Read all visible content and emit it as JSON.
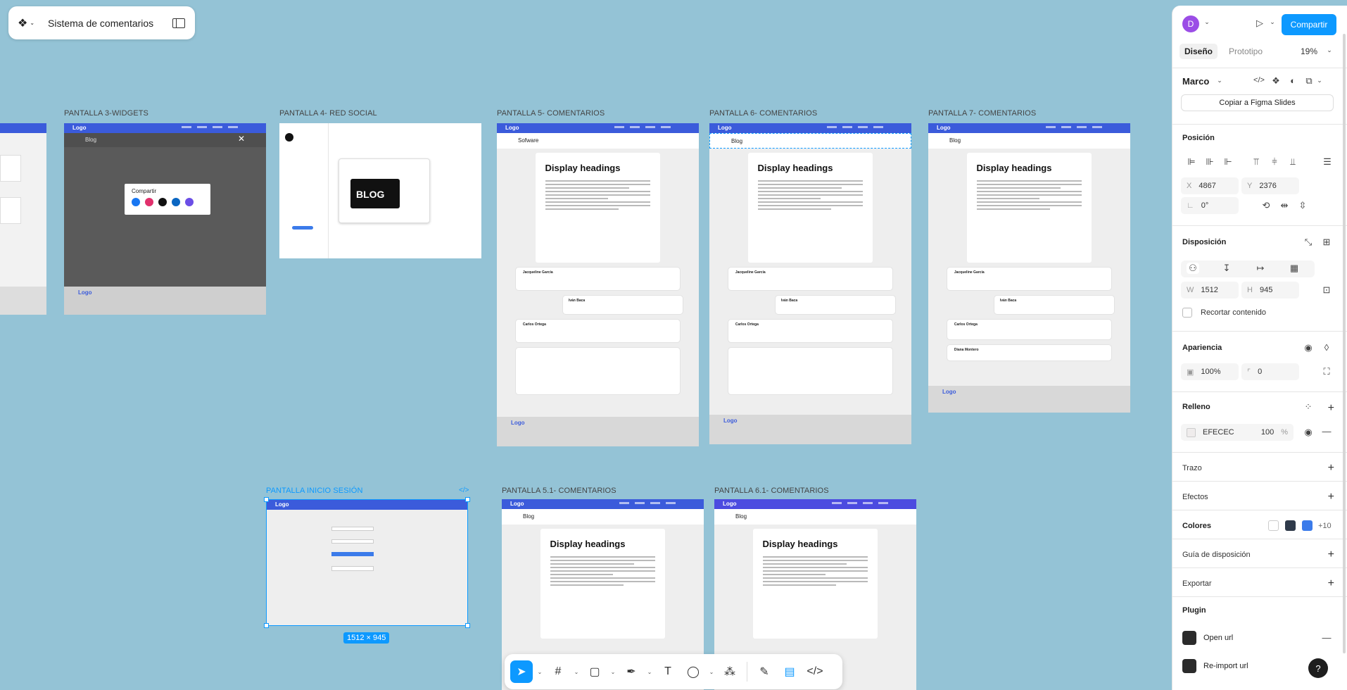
{
  "topbar": {
    "file_title": "Sistema de comentarios"
  },
  "frames": {
    "f3": "PANTALLA 3-WIDGETS",
    "f4": "PANTALLA 4- RED SOCIAL",
    "f5": "PANTALLA 5- COMENTARIOS",
    "f6": "PANTALLA 6- COMENTARIOS",
    "f7": "PANTALLA 7- COMENTARIOS",
    "login": "PANTALLA INICIO SESIÓN",
    "f51": "PANTALLA 5.1- COMENTARIOS",
    "f61": "PANTALLA 6.1- COMENTARIOS"
  },
  "frame_content": {
    "logo": "Logo",
    "blog": "Blog",
    "sofware": "Sofware",
    "display_heading": "Display headings",
    "compartir": "Compartir",
    "blog_banner": "BLOG",
    "commenters": [
      "Jacqueline García",
      "Iván Baca",
      "Carlos Ortega",
      "Diana Montero"
    ]
  },
  "selection": {
    "size_badge": "1512 × 945",
    "code_icon": "</>"
  },
  "right_panel": {
    "avatar_letter": "D",
    "share_button": "Compartir",
    "tabs": [
      "Diseño",
      "Prototipo"
    ],
    "zoom": "19%",
    "frame_type": "Marco",
    "copy_slides": "Copiar a Figma Slides",
    "position": {
      "title": "Posición",
      "x_label": "X",
      "x": "4867",
      "y_label": "Y",
      "y": "2376",
      "rotation": "0°"
    },
    "layout": {
      "title": "Disposición",
      "w_label": "W",
      "w": "1512",
      "h_label": "H",
      "h": "945",
      "clip": "Recortar contenido"
    },
    "appearance": {
      "title": "Apariencia",
      "opacity": "100%",
      "radius": "0"
    },
    "fill": {
      "title": "Relleno",
      "color": "EFECEC",
      "opacity": "100",
      "unit": "%"
    },
    "stroke": "Trazo",
    "effects": "Efectos",
    "colors": {
      "title": "Colores",
      "more": "+10",
      "swatches": [
        "#ffffff",
        "#2f3a4a",
        "#3b7bea"
      ]
    },
    "layout_guide": "Guía de disposición",
    "export": "Exportar",
    "plugin": {
      "title": "Plugin",
      "items": [
        "Open url",
        "Re-import url"
      ]
    },
    "help": "?"
  },
  "colors": {
    "accent": "#0d99ff",
    "canvas": "#94c3d6",
    "nav_blue": "#3b5bdb",
    "nav_purple": "#4c4be0"
  }
}
